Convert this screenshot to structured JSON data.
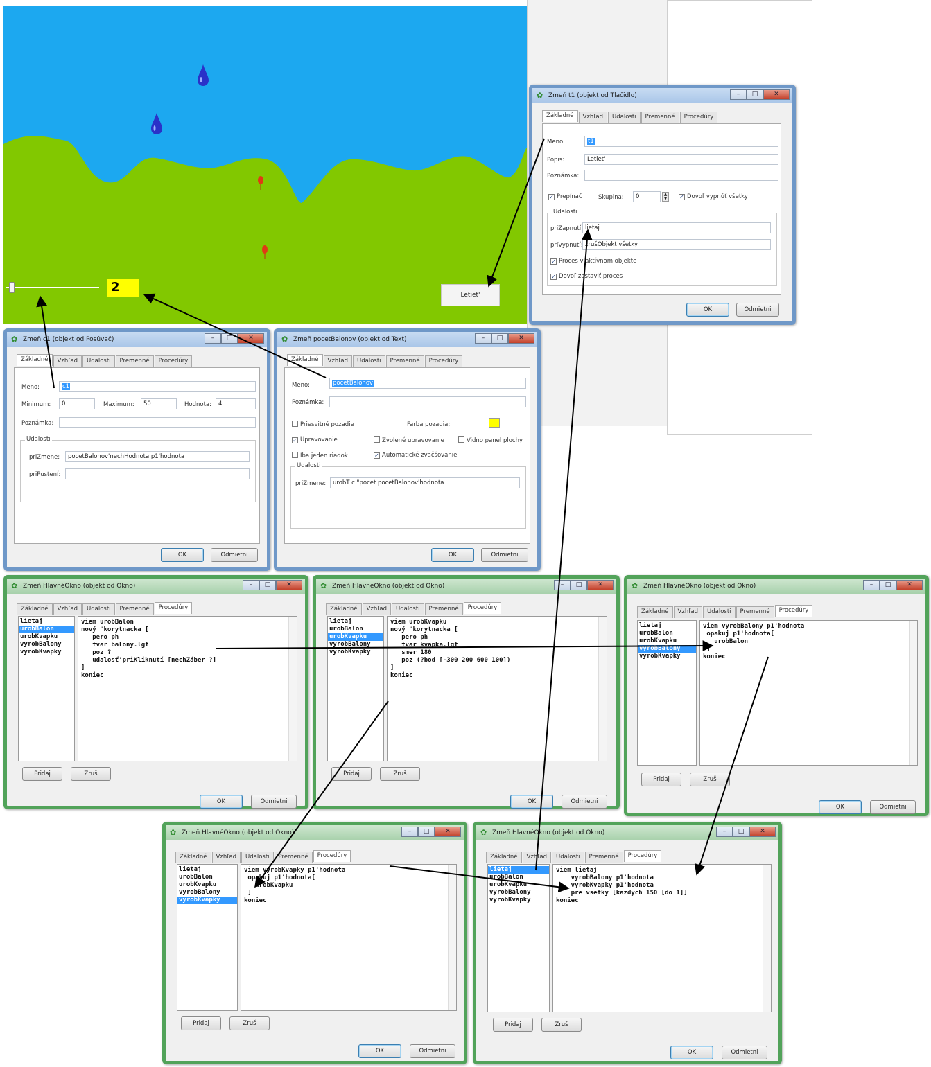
{
  "scene": {
    "counter_value": "2",
    "button_label": "Letiet'",
    "colors": {
      "sky": "#1ca8f0",
      "grass": "#82c800",
      "drop": "#2a32c8",
      "balloon": "#e03a14",
      "counter_bg": "#ffff00"
    }
  },
  "windows": {
    "button_props": {
      "title": "Zmeň t1 (objekt od Tlačidlo)",
      "tabs": [
        "Základné",
        "Vzhľad",
        "Udalosti",
        "Premenné",
        "Procedúry"
      ],
      "fields": {
        "meno_label": "Meno:",
        "meno_value": "t1",
        "popis_label": "Popis:",
        "popis_value": "Letiet'",
        "poznamka_label": "Poznámka:",
        "poznamka_value": "",
        "prepinac": "Prepínač",
        "skupina_label": "Skupina:",
        "skupina_value": "0",
        "dovol_vypnut": "Dovoľ vypnúť všetky",
        "udalosti": "Udalosti",
        "pri_zapnuti_label": "priZapnutí:",
        "pri_zapnuti_value": "lietaj",
        "pri_vypnuti_label": "priVypnutí:",
        "pri_vypnuti_value": "zrušObjekt všetky",
        "proces_aktivny": "Proces v aktívnom objekte",
        "dovol_zastavit": "Dovoľ zastaviť proces"
      },
      "ok": "OK",
      "cancel": "Odmietni"
    },
    "slider_props": {
      "title": "Zmeň c1 (objekt od Posúvač)",
      "tabs": [
        "Základné",
        "Vzhľad",
        "Udalosti",
        "Premenné",
        "Procedúry"
      ],
      "fields": {
        "meno_label": "Meno:",
        "meno_value": "c1",
        "min_label": "Minimum:",
        "min_value": "0",
        "max_label": "Maximum:",
        "max_value": "50",
        "hodnota_label": "Hodnota:",
        "hodnota_value": "4",
        "poznamka_label": "Poznámka:",
        "poznamka_value": "",
        "udalosti": "Udalosti",
        "pri_zmene_label": "priZmene:",
        "pri_zmene_value": "pocetBalonov'nechHodnota p1'hodnota",
        "pri_pusteni_label": "priPustení:",
        "pri_pusteni_value": ""
      },
      "ok": "OK",
      "cancel": "Odmietni"
    },
    "text_props": {
      "title": "Zmeň pocetBalonov (objekt od Text)",
      "tabs": [
        "Základné",
        "Vzhľad",
        "Udalosti",
        "Premenné",
        "Procedúry"
      ],
      "fields": {
        "meno_label": "Meno:",
        "meno_value": "pocetBalonov",
        "poznamka_label": "Poznámka:",
        "poznamka_value": "",
        "priesvitne": "Priesvitné pozadie",
        "farba_label": "Farba pozadia:",
        "upravovanie": "Upravovanie",
        "zvolene": "Zvolené upravovanie",
        "vodorovny": "Vidno panel plochy",
        "jeden_riadok": "Iba jeden riadok",
        "auto_zvacsovanie": "Automatické zväčšovanie",
        "udalosti": "Udalosti",
        "pri_zmene_label": "priZmene:",
        "pri_zmene_value": "urobT c \"pocet pocetBalonov'hodnota"
      },
      "ok": "OK",
      "cancel": "Odmietni"
    },
    "proc_common": {
      "title": "Zmeň HlavnéOkno (objekt od Okno)",
      "tabs": [
        "Základné",
        "Vzhľad",
        "Udalosti",
        "Premenné",
        "Procedúry"
      ],
      "procedures": [
        "lietaj",
        "urobBalon",
        "urobKvapku",
        "vyrobBalony",
        "vyrobKvapky"
      ],
      "add": "Pridaj",
      "remove": "Zruš",
      "ok": "OK",
      "cancel": "Odmietni"
    },
    "proc_urobBalon": {
      "code": [
        "viem urobBalon",
        "nový \"korytnacka [",
        "   pero ph",
        "   tvar balony.lgf",
        "   poz ?",
        "   udalosť'priKliknutí [nechZáber ?]",
        "]",
        "koniec"
      ]
    },
    "proc_urobKvapku": {
      "code": [
        "viem urobKvapku",
        "nový \"korytnacka [",
        "   pero ph",
        "   tvar kvapka.lgf",
        "   smer 180",
        "   poz (?bod [-300 200 600 100])",
        "]",
        "koniec"
      ]
    },
    "proc_vyrobBalony": {
      "code": [
        "viem vyrobBalony p1'hodnota",
        " opakuj p1'hodnota[",
        "   urobBalon",
        " ]",
        "koniec"
      ]
    },
    "proc_vyrobKvapky": {
      "code": [
        "viem vyrobKvapky p1'hodnota",
        " opakuj p1'hodnota[",
        "   urobKvapku",
        " ]",
        "koniec"
      ]
    },
    "proc_lietaj": {
      "code": [
        "viem lietaj",
        "    vyrobBalony p1'hodnota",
        "    vyrobKvapky p1'hodnota",
        "    pre vsetky [kazdych 150 [do 1]]",
        "koniec"
      ]
    }
  }
}
